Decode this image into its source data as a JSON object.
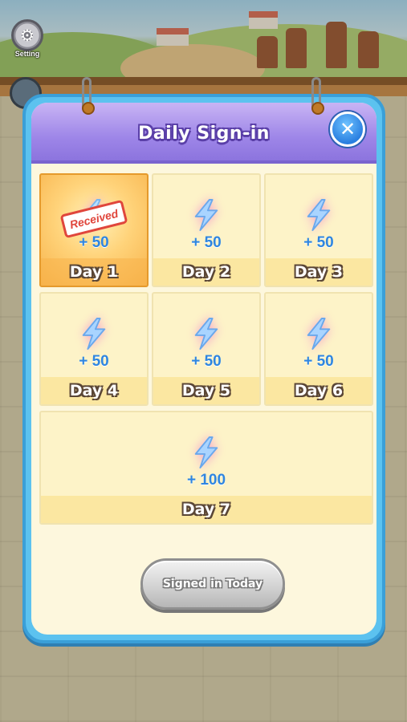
{
  "background": {
    "setting_label": "Setting",
    "setting_icon": "gear-icon"
  },
  "dialog": {
    "title": "Daily Sign-in",
    "close_icon": "close-icon",
    "close_symbol": "✕",
    "accent_color": "#5cc2ef",
    "header_color": "#9e86e8"
  },
  "days": [
    {
      "label": "Day 1",
      "reward": "+ 50",
      "status": "received",
      "stamp": "Received",
      "icon": "energy-bolt-icon"
    },
    {
      "label": "Day 2",
      "reward": "+ 50",
      "status": "pending",
      "icon": "energy-bolt-icon"
    },
    {
      "label": "Day 3",
      "reward": "+ 50",
      "status": "pending",
      "icon": "energy-bolt-icon"
    },
    {
      "label": "Day 4",
      "reward": "+ 50",
      "status": "pending",
      "icon": "energy-bolt-icon"
    },
    {
      "label": "Day 5",
      "reward": "+ 50",
      "status": "pending",
      "icon": "energy-bolt-icon"
    },
    {
      "label": "Day 6",
      "reward": "+ 50",
      "status": "pending",
      "icon": "energy-bolt-icon"
    },
    {
      "label": "Day 7",
      "reward": "+ 100",
      "status": "pending",
      "icon": "energy-bolt-icon"
    }
  ],
  "footer": {
    "button_label": "Signed in Today",
    "button_state": "disabled"
  }
}
